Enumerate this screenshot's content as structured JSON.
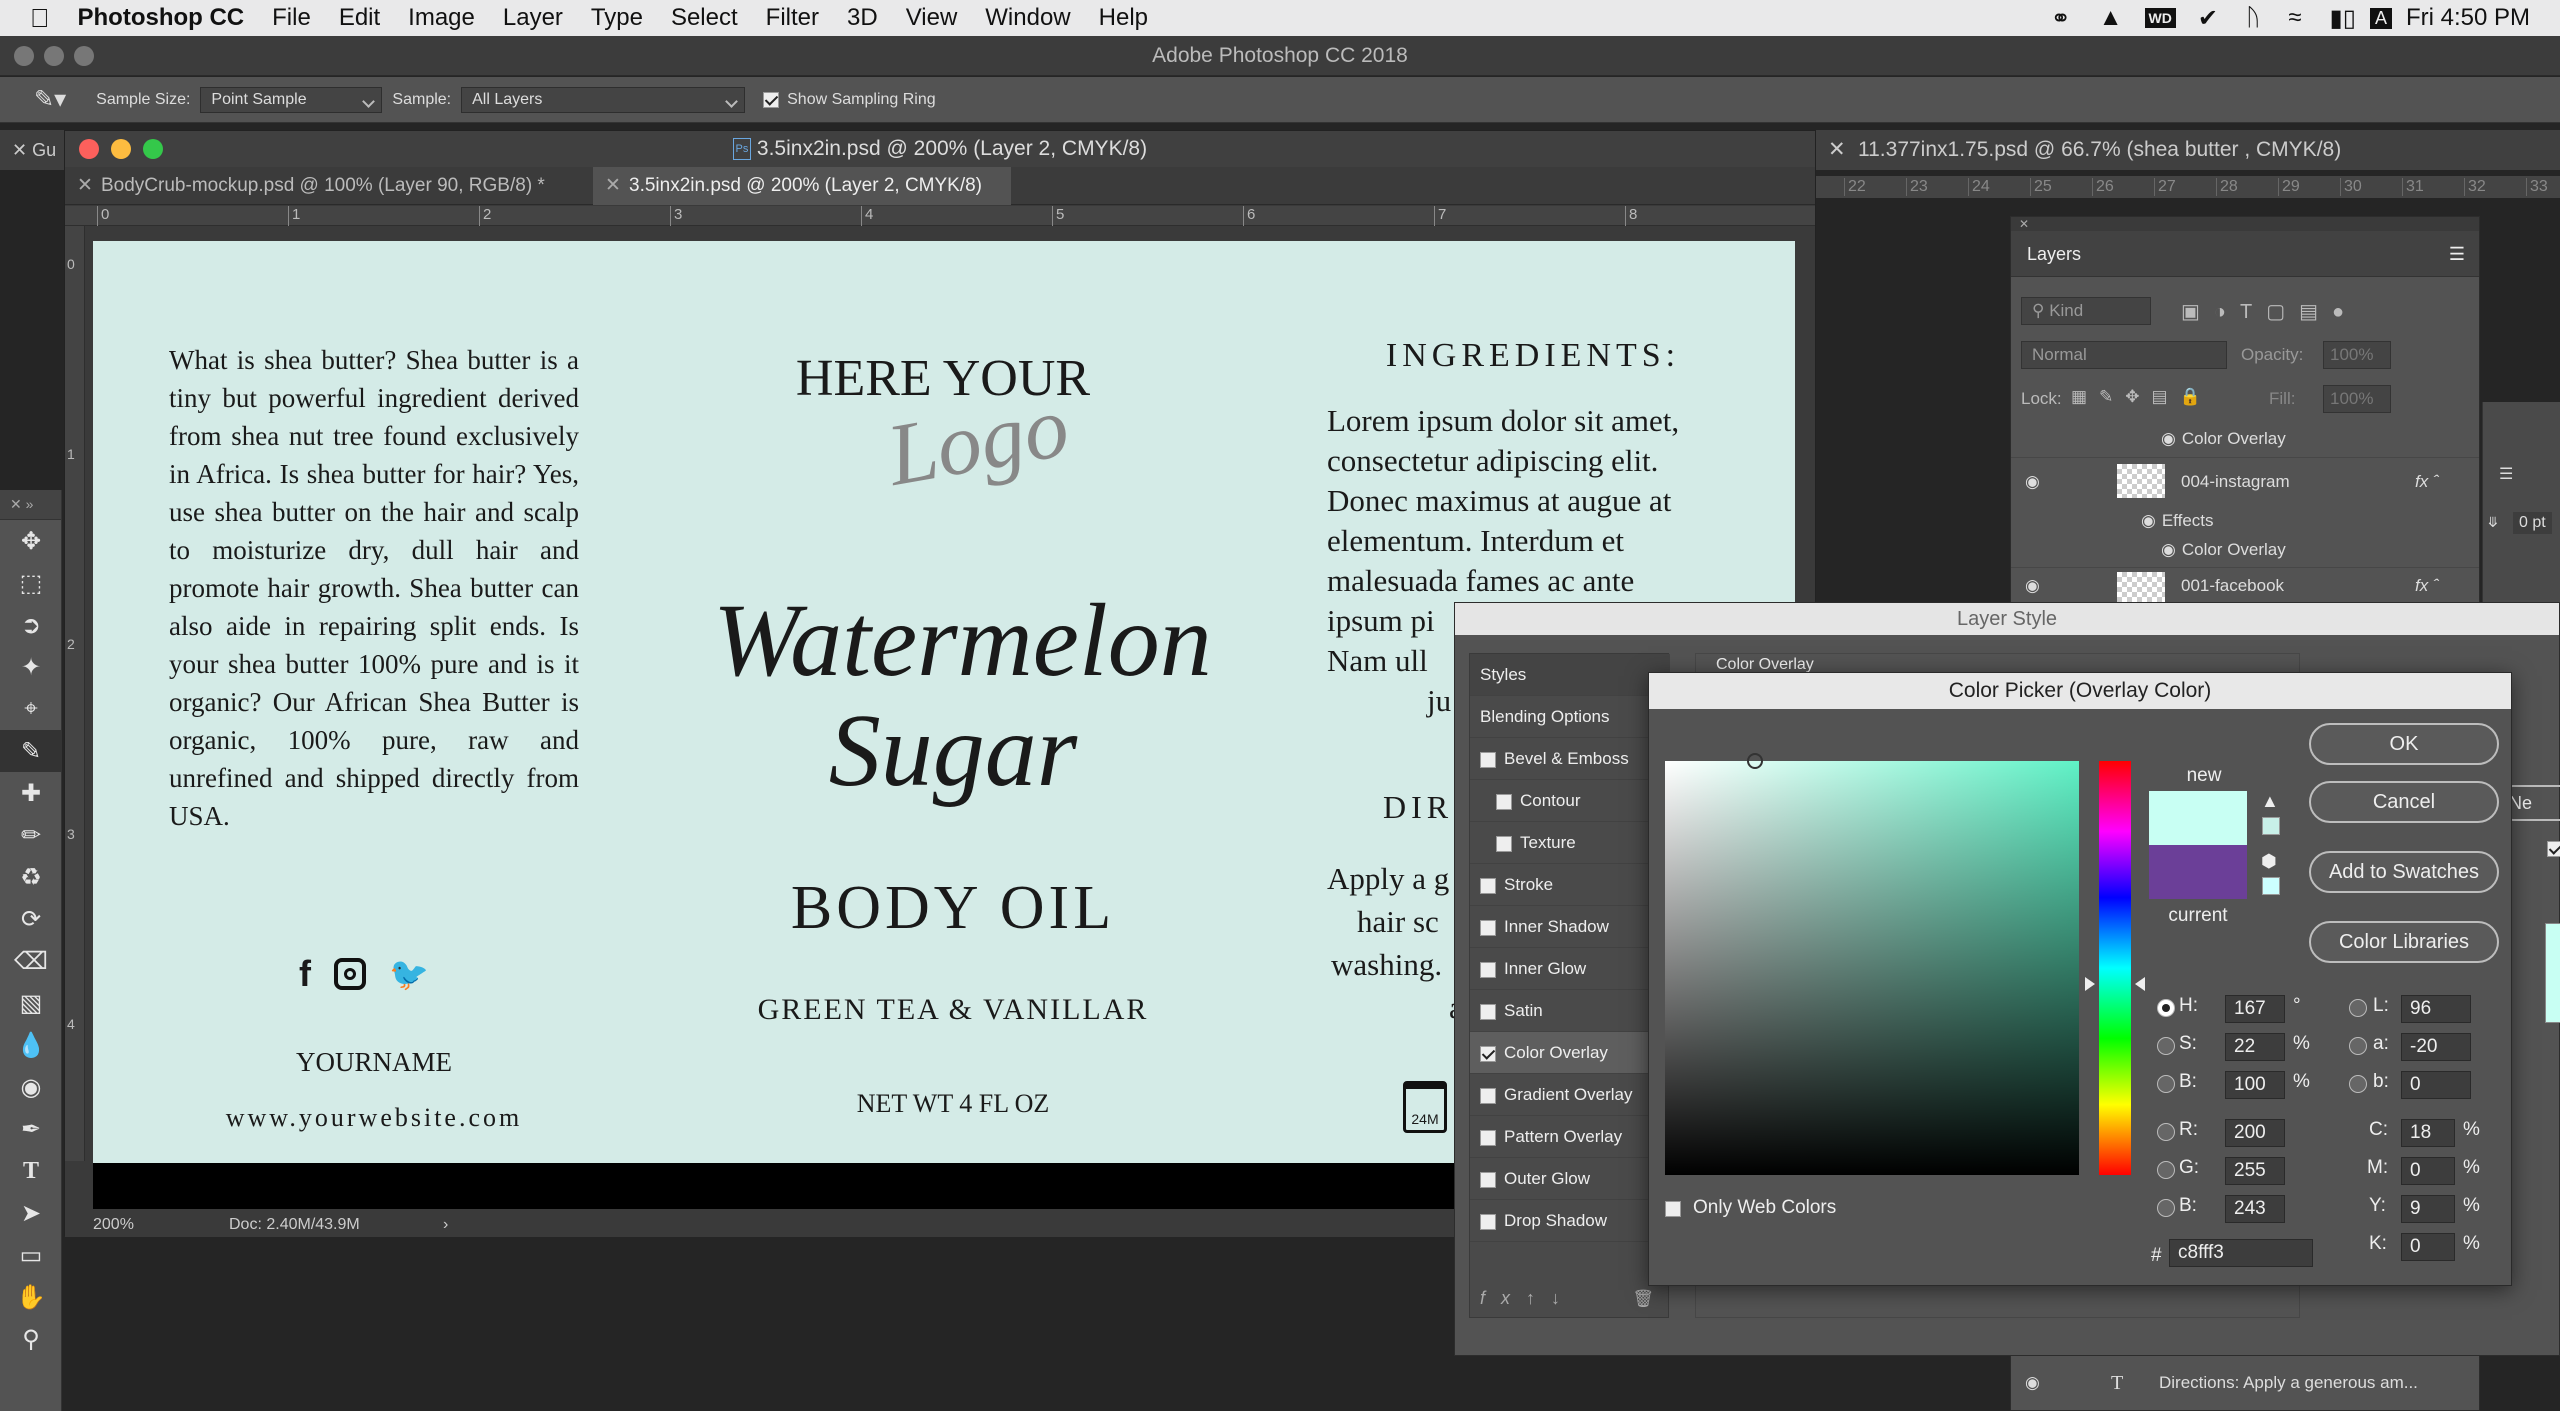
{
  "menubar": {
    "app": "Photoshop CC",
    "items": [
      "File",
      "Edit",
      "Image",
      "Layer",
      "Type",
      "Select",
      "Filter",
      "3D",
      "View",
      "Window",
      "Help"
    ],
    "clock": "Fri 4:50 PM"
  },
  "window_title": "Adobe Photoshop CC 2018",
  "options": {
    "sample_size_label": "Sample Size:",
    "sample_size_value": "Point Sample",
    "sample_label": "Sample:",
    "sample_value": "All Layers",
    "show_ring_label": "Show Sampling Ring"
  },
  "document": {
    "window_title": "3.5inx2in.psd @ 200% (Layer 2, CMYK/8)",
    "tabs": [
      "BodyCrub-mockup.psd @ 100% (Layer 90, RGB/8) *",
      "3.5inx2in.psd @ 200% (Layer 2, CMYK/8)"
    ],
    "ruler_marks": [
      "0",
      "1",
      "2",
      "3",
      "4",
      "5",
      "6",
      "7",
      "8"
    ],
    "vruler_marks": [
      "0",
      "1",
      "2",
      "3",
      "4"
    ],
    "zoom": "200%",
    "doc_size": "Doc: 2.40M/43.9M",
    "other_tab": "11.377inx1.75.psd @ 66.7% (shea butter , CMYK/8)",
    "other_tab_left": "Gu",
    "right_ruler": [
      "22",
      "23",
      "24",
      "25",
      "26",
      "27",
      "28",
      "29",
      "30",
      "31",
      "32",
      "33"
    ]
  },
  "label": {
    "left_text": "What is shea butter? Shea butter is a tiny but powerful ingredient derived from shea nut tree found exclusively in Africa. Is shea butter for hair? Yes, use shea butter on the hair and scalp to moisturize dry, dull hair and promote hair growth. Shea butter can also aide in repairing split ends. Is your shea butter 100% pure and is it organic? Our African Shea Butter is organic, 100% pure, raw and unrefined and shipped directly from USA.",
    "name": "YOURNAME",
    "website": "www.yourwebsite.com",
    "logo_top": "HERE YOUR",
    "logo_script": "Logo",
    "product_line1": "Watermelon",
    "product_line2": "Sugar",
    "product_type": "BODY OIL",
    "scent": "GREEN TEA & VANILLAR",
    "net_wt": "NET WT 4 FL OZ",
    "ingredients_title": "INGREDIENTS:",
    "ingredients_lines": [
      "Lorem ipsum dolor sit amet,",
      "consectetur adipiscing elit.",
      "Donec maximus at augue at",
      "elementum. Interdum et",
      "malesuada fames ac ante",
      "ipsum pi",
      "Nam ull",
      "ju"
    ],
    "directions_partial": "DIR",
    "directions_lines": [
      "Apply a g",
      "hair sc",
      "washing.",
      "a"
    ],
    "pao": "24M"
  },
  "layers_panel": {
    "title": "Layers",
    "kind": "Kind",
    "blend": "Normal",
    "opacity_label": "Opacity:",
    "opacity": "100%",
    "lock_label": "Lock:",
    "fill_label": "Fill:",
    "fill": "100%",
    "rows": [
      {
        "name": "Color Overlay",
        "type": "effect"
      },
      {
        "name": "004-instagram",
        "type": "layer"
      },
      {
        "name": "Effects",
        "type": "effect"
      },
      {
        "name": "Color Overlay",
        "type": "effect"
      },
      {
        "name": "001-facebook",
        "type": "layer"
      }
    ],
    "bottom_row": "Directions:  Apply a generous am...",
    "right_peek": "0 pt"
  },
  "layer_style": {
    "title": "Layer Style",
    "styles_header": "Styles",
    "blending": "Blending Options",
    "section": "Color Overlay",
    "items": [
      {
        "label": "Bevel & Emboss",
        "checked": false,
        "indent": false
      },
      {
        "label": "Contour",
        "checked": false,
        "indent": true
      },
      {
        "label": "Texture",
        "checked": false,
        "indent": true
      },
      {
        "label": "Stroke",
        "checked": false,
        "indent": false
      },
      {
        "label": "Inner Shadow",
        "checked": false,
        "indent": false
      },
      {
        "label": "Inner Glow",
        "checked": false,
        "indent": false
      },
      {
        "label": "Satin",
        "checked": false,
        "indent": false
      },
      {
        "label": "Color Overlay",
        "checked": true,
        "indent": false
      },
      {
        "label": "Gradient Overlay",
        "checked": false,
        "indent": false
      },
      {
        "label": "Pattern Overlay",
        "checked": false,
        "indent": false
      },
      {
        "label": "Outer Glow",
        "checked": false,
        "indent": false
      },
      {
        "label": "Drop Shadow",
        "checked": false,
        "indent": false
      }
    ],
    "right_peek": "Ne"
  },
  "color_picker": {
    "title": "Color Picker (Overlay Color)",
    "new_label": "new",
    "current_label": "current",
    "new_color": "#c8fff3",
    "current_color": "#6b3f98",
    "ok": "OK",
    "cancel": "Cancel",
    "add_swatches": "Add to Swatches",
    "libraries": "Color Libraries",
    "only_web": "Only Web Colors",
    "hsb": [
      {
        "k": "H:",
        "v": "167",
        "u": "°"
      },
      {
        "k": "S:",
        "v": "22",
        "u": "%"
      },
      {
        "k": "B:",
        "v": "100",
        "u": "%"
      }
    ],
    "rgb": [
      {
        "k": "R:",
        "v": "200"
      },
      {
        "k": "G:",
        "v": "255"
      },
      {
        "k": "B:",
        "v": "243"
      }
    ],
    "lab": [
      {
        "k": "L:",
        "v": "96"
      },
      {
        "k": "a:",
        "v": "-20"
      },
      {
        "k": "b:",
        "v": "0"
      }
    ],
    "cmyk": [
      {
        "k": "C:",
        "v": "18",
        "u": "%"
      },
      {
        "k": "M:",
        "v": "0",
        "u": "%"
      },
      {
        "k": "Y:",
        "v": "9",
        "u": "%"
      },
      {
        "k": "K:",
        "v": "0",
        "u": "%"
      }
    ],
    "hash": "#",
    "hex": "c8fff3"
  }
}
